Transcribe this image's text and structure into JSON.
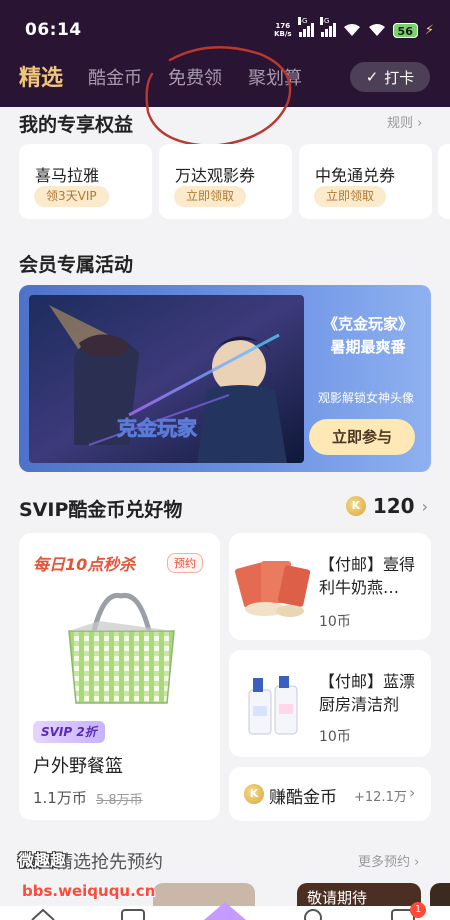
{
  "status_bar": {
    "time": "06:14",
    "net_speed_value": "176",
    "net_speed_unit": "KB/s",
    "signal1_tag": "5G",
    "signal2_tag": "5G",
    "battery": "56"
  },
  "tabs": [
    {
      "label": "精选",
      "active": true
    },
    {
      "label": "酷金币",
      "active": false
    },
    {
      "label": "免费领",
      "active": false
    },
    {
      "label": "聚划算",
      "active": false
    }
  ],
  "checkin": {
    "label": "打卡",
    "icon": "check-icon"
  },
  "exclusive_rights": {
    "title": "我的专享权益",
    "more": "规则",
    "items": [
      {
        "name": "喜马拉雅",
        "action": "领3天VIP"
      },
      {
        "name": "万达观影券",
        "action": "立即领取"
      },
      {
        "name": "中免通兑券",
        "action": "立即领取"
      }
    ]
  },
  "member_activity": {
    "title": "会员专属活动",
    "banner": {
      "art_text": "克金玩家",
      "title_line1": "《克金玩家》",
      "title_line2": "暑期最爽番",
      "subtitle": "观影解锁女神头像",
      "button": "立即参与"
    }
  },
  "svip_exchange": {
    "title": "SVIP酷金币兑好物",
    "coin_balance": "120",
    "coin_icon": "K",
    "flash_sale": {
      "title": "每日10点秒杀",
      "reserve_label": "预约",
      "svip_tag": "SVIP 2折",
      "product": "户外野餐篮",
      "price": "1.1万币",
      "old_price": "5.8万币"
    },
    "items": [
      {
        "title": "【付邮】壹得利牛奶燕…",
        "price": "10币"
      },
      {
        "title": "【付邮】蓝漂厨房清洁剂",
        "price": "10币"
      }
    ],
    "earn": {
      "label": "赚酷金币",
      "amount": "+12.1万"
    }
  },
  "presale": {
    "title": "会员精选抢先预约",
    "more": "更多预约",
    "chip_label": "敬请期待"
  },
  "watermark": {
    "line1": "微趣趣",
    "line2": "bbs.weiququ.cn"
  },
  "bottom_nav": {
    "badge": "1"
  },
  "colors": {
    "header_bg": "#2a1433",
    "active_tab": "#f2c678",
    "accent_red": "#e4553a",
    "gold_pill": "#fbeacb",
    "banner_blue": "#5a80d6"
  }
}
